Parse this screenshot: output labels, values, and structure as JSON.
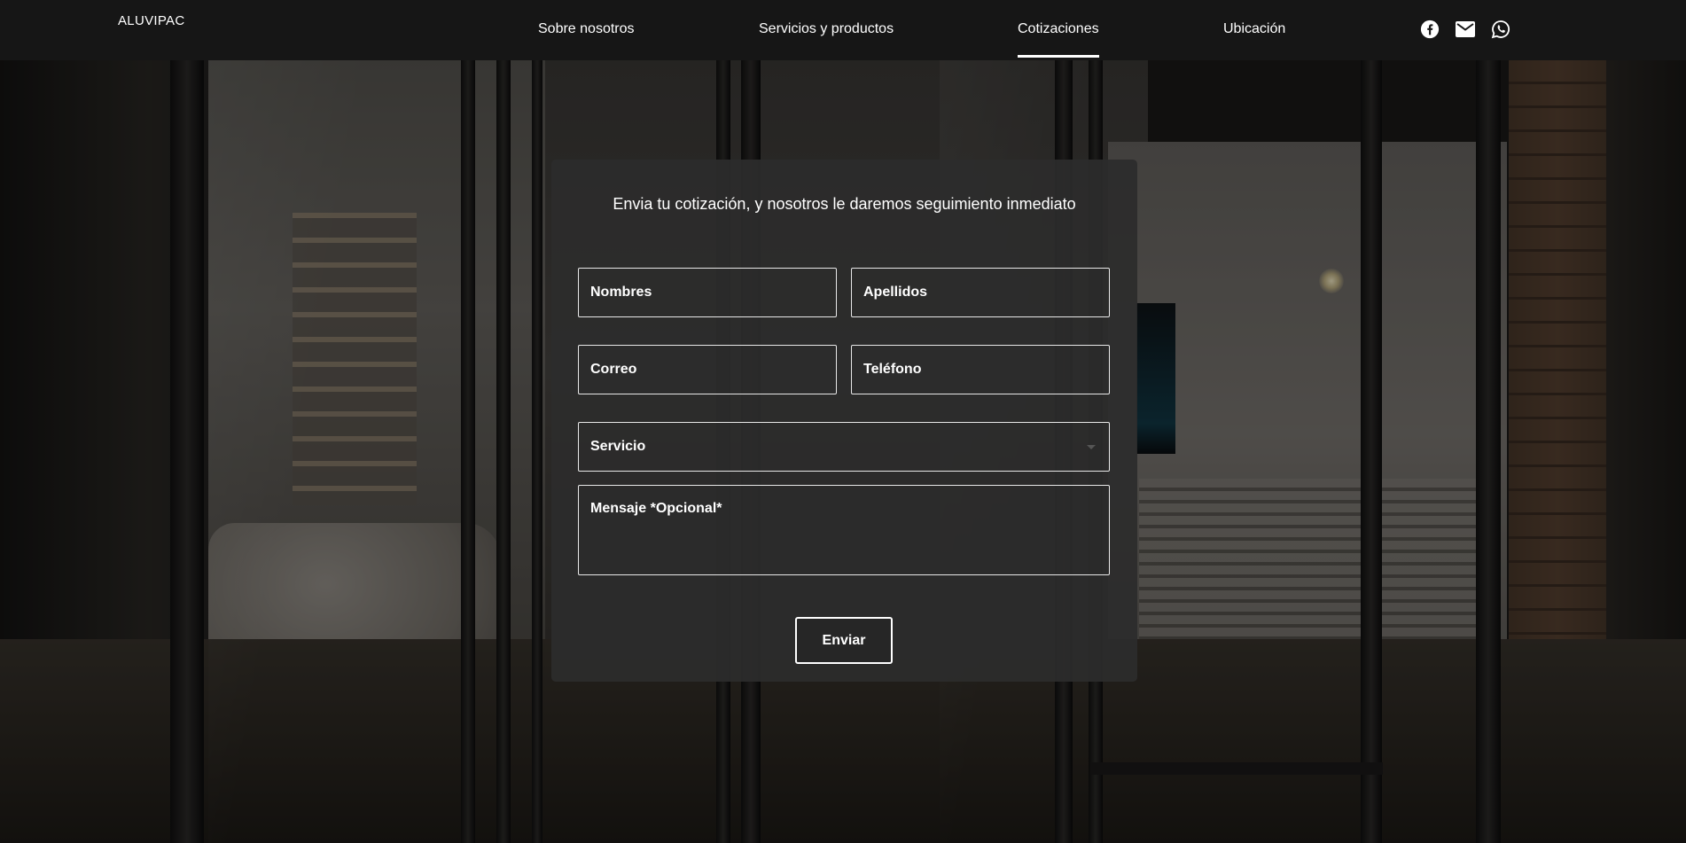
{
  "brand": {
    "name": "ALUVIPAC"
  },
  "nav": {
    "items": [
      {
        "label": "Sobre nosotros",
        "active": false
      },
      {
        "label": "Servicios y productos",
        "active": false
      },
      {
        "label": "Cotizaciones",
        "active": true
      },
      {
        "label": "Ubicación",
        "active": false
      }
    ]
  },
  "social": {
    "icons": [
      "facebook-icon",
      "mail-icon",
      "whatsapp-icon"
    ]
  },
  "form": {
    "title": "Envia tu cotización, y nosotros le daremos seguimiento inmediato",
    "nombres_placeholder": "Nombres",
    "apellidos_placeholder": "Apellidos",
    "correo_placeholder": "Correo",
    "telefono_placeholder": "Teléfono",
    "servicio_selected": "Servicio",
    "mensaje_placeholder": "Mensaje *Opcional*",
    "submit_label": "Enviar"
  },
  "colors": {
    "nav_background": "#161616",
    "panel_background": "#2c2c2c",
    "text": "#ffffff"
  }
}
